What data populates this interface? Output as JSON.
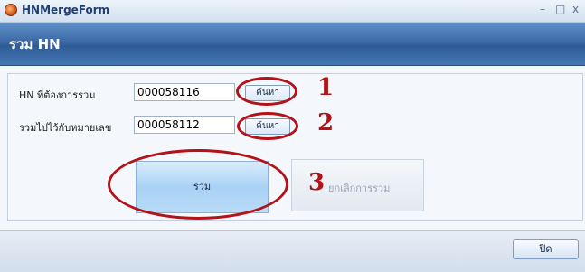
{
  "window": {
    "title": "HNMergeForm",
    "minimize": "–",
    "maximize": "□",
    "close": "x"
  },
  "header": {
    "title": "รวม HN"
  },
  "form": {
    "hn_source_label": "HN ที่ต้องการรวม",
    "hn_source_value": "000058116",
    "hn_target_label": "รวมไปไว้กับหมายเลข",
    "hn_target_value": "000058112",
    "search_label": "ค้นหา"
  },
  "actions": {
    "merge_label": "รวม",
    "cancel_merge_label": "ยกเลิกการรวม",
    "close_label": "ปิด"
  },
  "annotations": {
    "step1": "1",
    "step2": "2",
    "step3": "3",
    "color": "#b01418"
  }
}
